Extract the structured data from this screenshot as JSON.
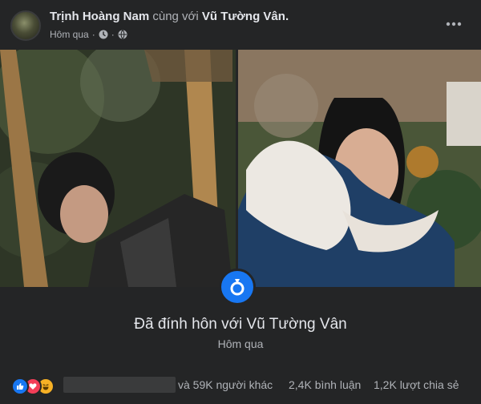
{
  "post": {
    "author": "Trịnh Hoàng Nam",
    "with_text": "cùng với",
    "tagged": "Vũ Tường Vân",
    "tagged_suffix": ".",
    "time": "Hôm qua",
    "separator": "·"
  },
  "event": {
    "title": "Đã đính hôn với Vũ Tường Vân",
    "date": "Hôm qua"
  },
  "footer": {
    "reaction_icons": [
      "like-icon",
      "love-icon",
      "haha-icon"
    ],
    "others_text": "và 59K người khác",
    "comments_text": "2,4K bình luận",
    "shares_text": "1,2K lượt chia sẻ"
  },
  "colors": {
    "background": "#242526",
    "accent": "#1877f2",
    "love": "#f33e58",
    "haha": "#f7b125"
  }
}
